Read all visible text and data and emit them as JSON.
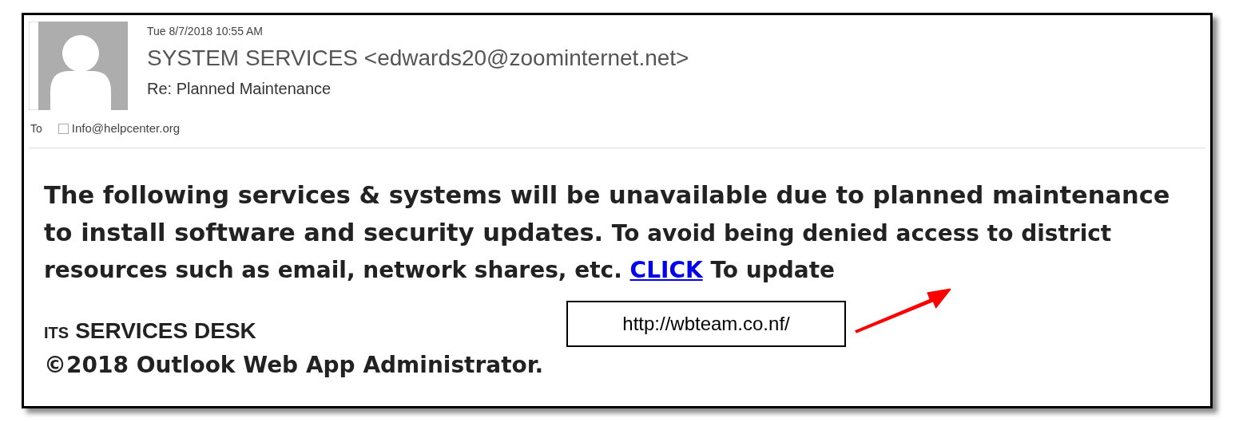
{
  "email": {
    "date": "Tue 8/7/2018 10:55 AM",
    "sender": "SYSTEM SERVICES <edwards20@zoominternet.net>",
    "subject": "Re: Planned Maintenance",
    "to_label": "To",
    "recipients": [
      {
        "address": "Info@helpcenter.org",
        "checked": false
      }
    ]
  },
  "body": {
    "lead": "The following services & systems will be unavailable due to planned maintenance to install software and security updates.",
    "text": "To avoid being denied access to district resources such as email, network shares, etc.",
    "link": "CLICK",
    "tail": "To update",
    "signature_prefix": "ITS",
    "signature_title": "SERVICES DESK",
    "signature_line": "©2018 Outlook Web App Administrator."
  },
  "annotation": {
    "url": "http://wbteam.co.nf/"
  }
}
